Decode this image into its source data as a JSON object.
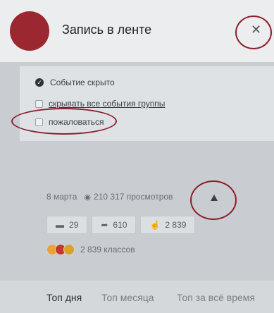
{
  "header": {
    "title": "Запись в ленте",
    "close_icon": "close-icon"
  },
  "options": {
    "hidden_label": "Событие скрыто",
    "hide_all_label": "скрывать все события группы",
    "report_label": "пожаловаться"
  },
  "post": {
    "date": "8 марта",
    "views": "210 317 просмотров",
    "comments": "29",
    "shares": "610",
    "likes": "2 839",
    "reactions_text": "2 839 классов"
  },
  "tabs": [
    {
      "label": "Топ дня"
    },
    {
      "label": "Топ месяца"
    },
    {
      "label": "Топ за всё время"
    }
  ],
  "colors": {
    "annotation_ring": "#8d1d2c",
    "avatar": "#9b2730"
  }
}
